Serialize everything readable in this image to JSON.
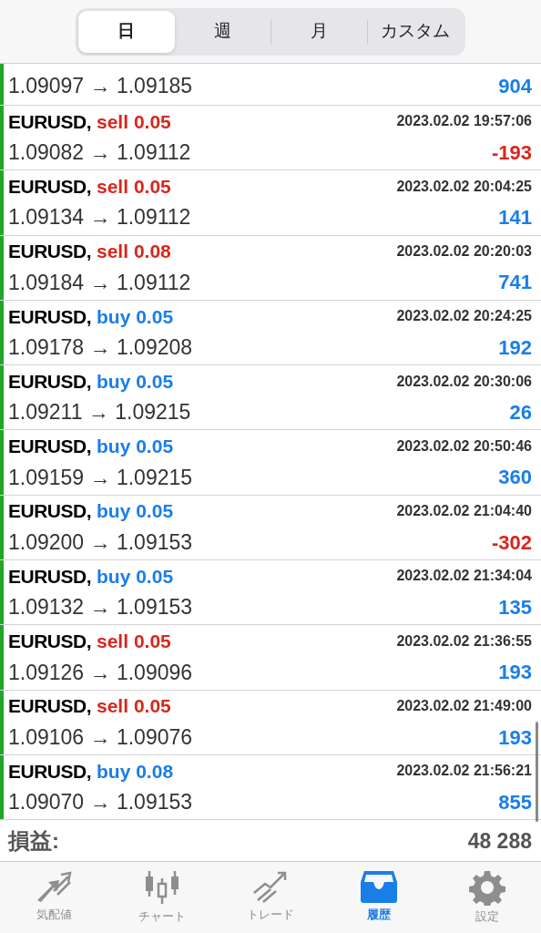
{
  "period_tabs": [
    {
      "label": "日",
      "selected": true
    },
    {
      "label": "週",
      "selected": false
    },
    {
      "label": "月",
      "selected": false
    },
    {
      "label": "カスタム",
      "selected": false
    }
  ],
  "partial_row": {
    "prices": "1.09097 → 1.09185",
    "profit": "904",
    "loss": false
  },
  "deals": [
    {
      "symbol": "EURUSD,",
      "kind": "sell",
      "volume": "sell 0.05",
      "time": "2023.02.02 19:57:06",
      "prices": "1.09082 → 1.09112",
      "profit": "-193",
      "loss": true
    },
    {
      "symbol": "EURUSD,",
      "kind": "sell",
      "volume": "sell 0.05",
      "time": "2023.02.02 20:04:25",
      "prices": "1.09134 → 1.09112",
      "profit": "141",
      "loss": false
    },
    {
      "symbol": "EURUSD,",
      "kind": "sell",
      "volume": "sell 0.08",
      "time": "2023.02.02 20:20:03",
      "prices": "1.09184 → 1.09112",
      "profit": "741",
      "loss": false
    },
    {
      "symbol": "EURUSD,",
      "kind": "buy",
      "volume": "buy 0.05",
      "time": "2023.02.02 20:24:25",
      "prices": "1.09178 → 1.09208",
      "profit": "192",
      "loss": false
    },
    {
      "symbol": "EURUSD,",
      "kind": "buy",
      "volume": "buy 0.05",
      "time": "2023.02.02 20:30:06",
      "prices": "1.09211 → 1.09215",
      "profit": "26",
      "loss": false
    },
    {
      "symbol": "EURUSD,",
      "kind": "buy",
      "volume": "buy 0.05",
      "time": "2023.02.02 20:50:46",
      "prices": "1.09159 → 1.09215",
      "profit": "360",
      "loss": false
    },
    {
      "symbol": "EURUSD,",
      "kind": "buy",
      "volume": "buy 0.05",
      "time": "2023.02.02 21:04:40",
      "prices": "1.09200 → 1.09153",
      "profit": "-302",
      "loss": true
    },
    {
      "symbol": "EURUSD,",
      "kind": "buy",
      "volume": "buy 0.05",
      "time": "2023.02.02 21:34:04",
      "prices": "1.09132 → 1.09153",
      "profit": "135",
      "loss": false
    },
    {
      "symbol": "EURUSD,",
      "kind": "sell",
      "volume": "sell 0.05",
      "time": "2023.02.02 21:36:55",
      "prices": "1.09126 → 1.09096",
      "profit": "193",
      "loss": false
    },
    {
      "symbol": "EURUSD,",
      "kind": "sell",
      "volume": "sell 0.05",
      "time": "2023.02.02 21:49:00",
      "prices": "1.09106 → 1.09076",
      "profit": "193",
      "loss": false
    },
    {
      "symbol": "EURUSD,",
      "kind": "buy",
      "volume": "buy 0.08",
      "time": "2023.02.02 21:56:21",
      "prices": "1.09070 → 1.09153",
      "profit": "855",
      "loss": false
    }
  ],
  "summary": {
    "label": "損益:",
    "value": "48 288"
  },
  "nav": [
    {
      "kind": "quotes",
      "label": "気配値",
      "selected": false
    },
    {
      "kind": "chart",
      "label": "チャート",
      "selected": false
    },
    {
      "kind": "trade",
      "label": "トレード",
      "selected": false
    },
    {
      "kind": "history",
      "label": "履歴",
      "selected": true
    },
    {
      "kind": "settings",
      "label": "設定",
      "selected": false
    }
  ]
}
